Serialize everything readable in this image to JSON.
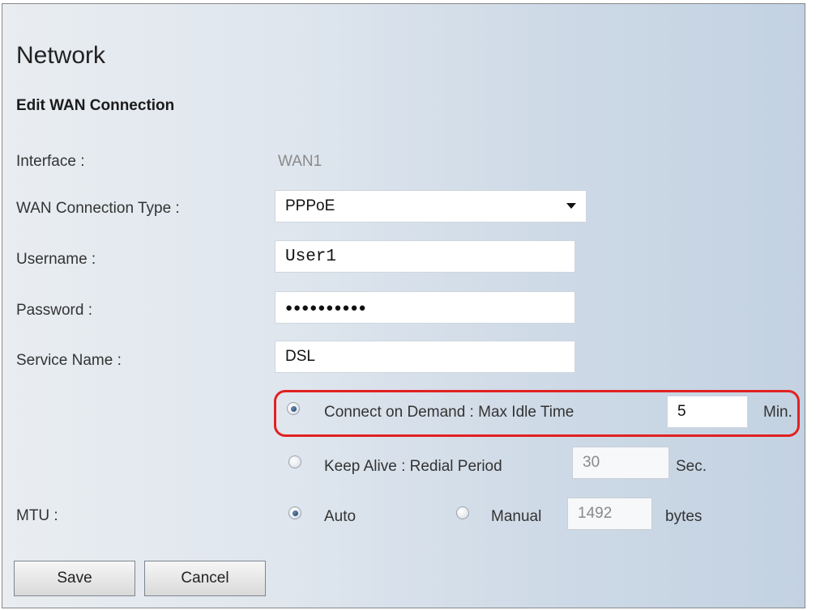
{
  "page": {
    "title": "Network",
    "subtitle": "Edit WAN Connection"
  },
  "form": {
    "interface": {
      "label": "Interface :",
      "value": "WAN1"
    },
    "wan_type": {
      "label": "WAN Connection Type :",
      "value": "PPPoE"
    },
    "username": {
      "label": "Username :",
      "value": "User1"
    },
    "password": {
      "label": "Password :",
      "value": "●●●●●●●●●●"
    },
    "service_name": {
      "label": "Service Name :",
      "value": "DSL"
    },
    "connect_on_demand": {
      "label": "Connect on Demand : Max Idle Time",
      "value": "5",
      "unit": "Min.",
      "selected": true
    },
    "keep_alive": {
      "label": "Keep Alive : Redial Period",
      "value": "30",
      "unit": "Sec.",
      "selected": false
    },
    "mtu": {
      "label": "MTU :",
      "auto_label": "Auto",
      "manual_label": "Manual",
      "manual_value": "1492",
      "unit": "bytes",
      "mode": "Auto"
    }
  },
  "buttons": {
    "save": "Save",
    "cancel": "Cancel"
  },
  "colors": {
    "highlight": "#e12121",
    "radio_selected": "#2a4c79"
  }
}
